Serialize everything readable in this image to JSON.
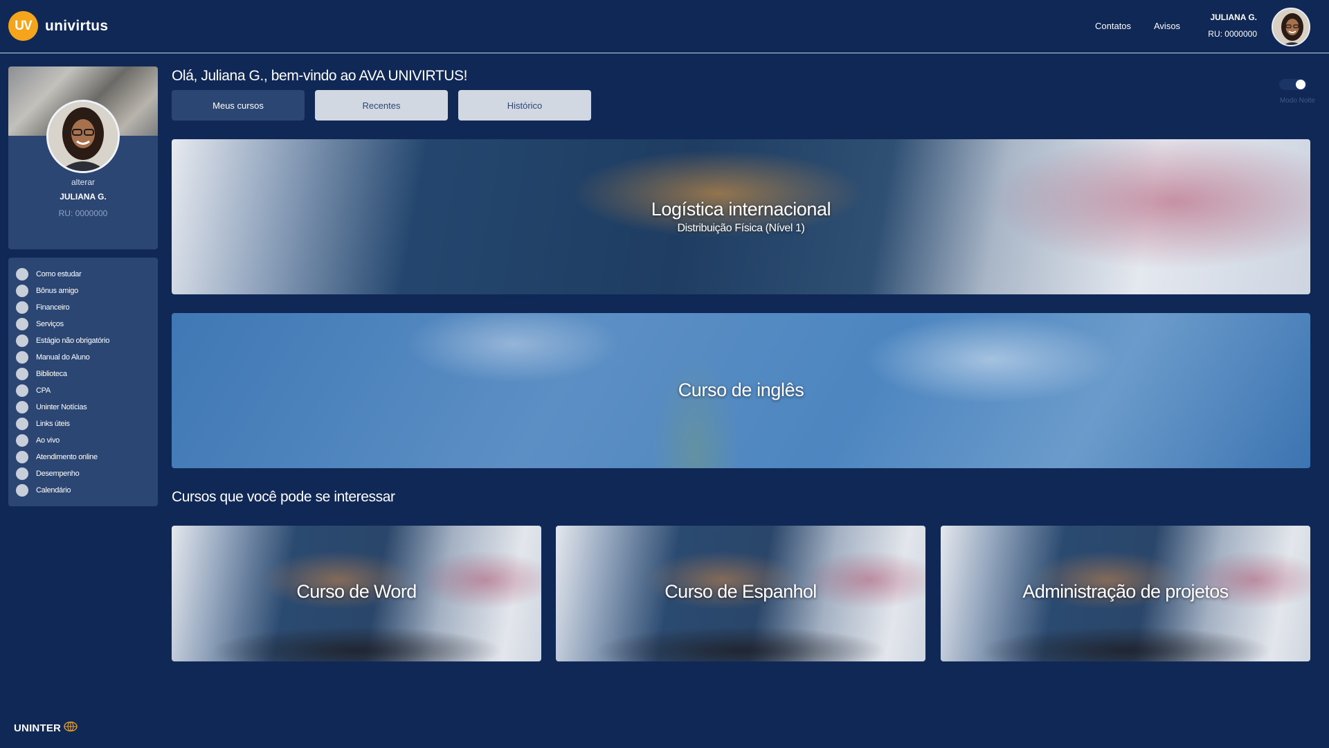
{
  "header": {
    "logo_badge": "UV",
    "logo_text": "univirtus",
    "nav": {
      "contatos": "Contatos",
      "avisos": "Avisos"
    },
    "user_name": "JULIANA G.",
    "user_ru": "RU: 0000000"
  },
  "profile": {
    "alterar": "alterar",
    "name": "JULIANA G.",
    "ru": "RU: 0000000"
  },
  "menu": {
    "items": [
      {
        "label": "Como estudar"
      },
      {
        "label": "Bônus amigo"
      },
      {
        "label": "Financeiro"
      },
      {
        "label": "Serviços"
      },
      {
        "label": "Estágio não obrigatório"
      },
      {
        "label": "Manual do Aluno"
      },
      {
        "label": "Biblioteca"
      },
      {
        "label": "CPA"
      },
      {
        "label": "Uninter Notícias"
      },
      {
        "label": "Links úteis"
      },
      {
        "label": "Ao vivo"
      },
      {
        "label": "Atendimento online"
      },
      {
        "label": "Desempenho"
      },
      {
        "label": "Calendário"
      }
    ]
  },
  "main": {
    "greeting": "Olá, Juliana G., bem-vindo ao AVA UNIVIRTUS!",
    "tabs": {
      "meus_cursos": "Meus cursos",
      "recentes": "Recentes",
      "historico": "Histórico"
    },
    "night_mode_label": "Modo Noite",
    "night_mode_on": true,
    "courses": [
      {
        "title": "Logística internacional",
        "subtitle": "Distribuição Física (Nível 1)"
      },
      {
        "title": "Curso de inglês"
      }
    ],
    "suggestions_title": "Cursos que você pode se interessar",
    "suggestions": [
      {
        "title": "Curso de Word"
      },
      {
        "title": "Curso de Espanhol"
      },
      {
        "title": "Administração de projetos"
      }
    ]
  },
  "footer": {
    "brand": "UNINTER"
  },
  "colors": {
    "background": "#0f2855",
    "panel": "#2b4673",
    "accent": "#f4a51c",
    "button_secondary": "#d2d8e2"
  }
}
